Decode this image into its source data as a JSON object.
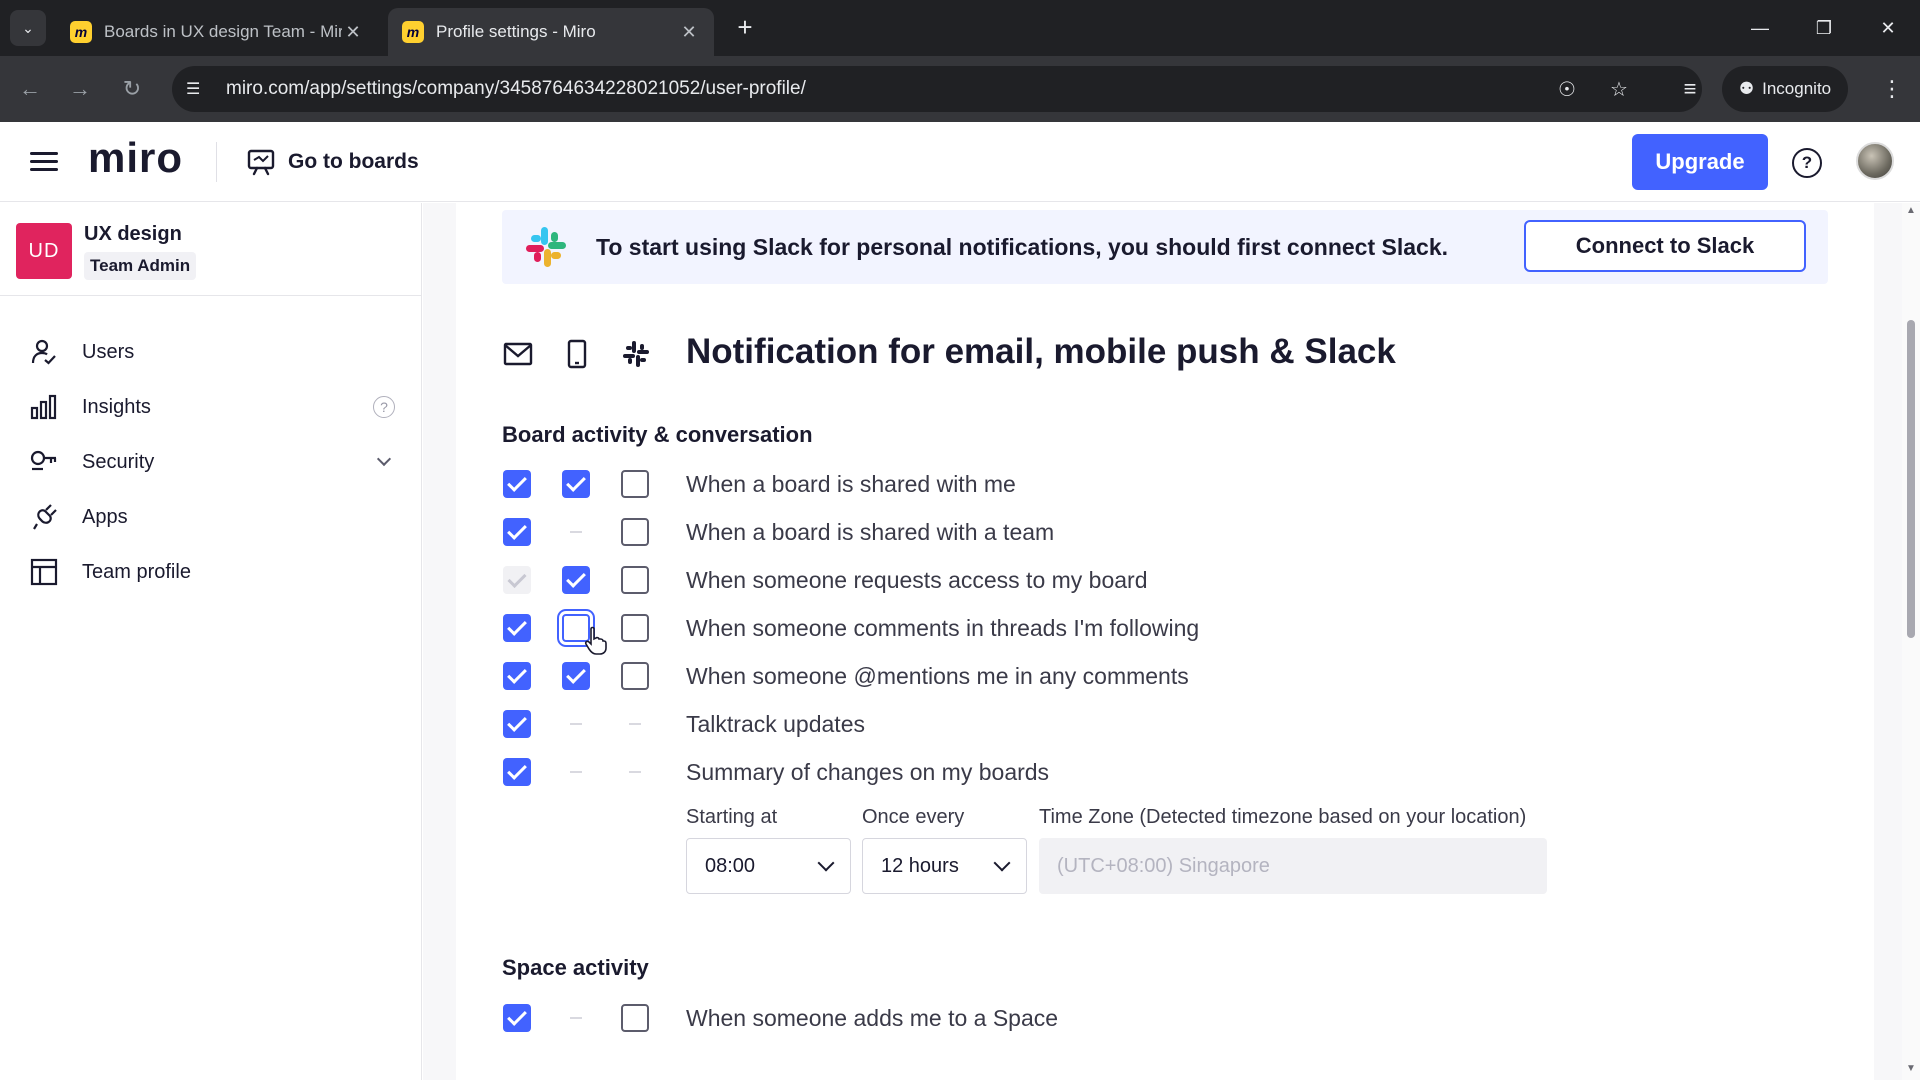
{
  "browser": {
    "tabs": [
      {
        "title": "Boards in UX design Team - Miro",
        "active": false
      },
      {
        "title": "Profile settings - Miro",
        "active": true
      }
    ],
    "favicon_letter": "m",
    "url": "miro.com/app/settings/company/3458764634228021052/user-profile/",
    "incognito_label": "Incognito"
  },
  "header": {
    "logo": "miro",
    "go_to_boards": "Go to boards",
    "upgrade": "Upgrade",
    "help": "?"
  },
  "sidebar": {
    "team_initials": "UD",
    "team_name": "UX design",
    "team_role": "Team Admin",
    "items": [
      {
        "label": "Users",
        "icon": "user-check-icon"
      },
      {
        "label": "Insights",
        "icon": "bar-chart-icon"
      },
      {
        "label": "Security",
        "icon": "key-icon"
      },
      {
        "label": "Apps",
        "icon": "plug-icon"
      },
      {
        "label": "Team profile",
        "icon": "layout-icon"
      }
    ]
  },
  "banner": {
    "text": "To start using Slack for personal notifications, you should first connect Slack.",
    "button": "Connect to Slack"
  },
  "notifications": {
    "title": "Notification for email, mobile push & Slack",
    "columns": [
      "email-icon",
      "mobile-icon",
      "slack-icon"
    ],
    "groups": [
      {
        "title": "Board activity & conversation",
        "rows": [
          {
            "label": "When a board is shared with me",
            "email": "on",
            "mobile": "on",
            "slack": "off"
          },
          {
            "label": "When a board is shared with a team",
            "email": "on",
            "mobile": "none",
            "slack": "off"
          },
          {
            "label": "When someone requests access to my board",
            "email": "disabled",
            "mobile": "on",
            "slack": "off"
          },
          {
            "label": "When someone comments in threads I'm following",
            "email": "on",
            "mobile": "focus",
            "slack": "off"
          },
          {
            "label": "When someone @mentions me in any comments",
            "email": "on",
            "mobile": "on",
            "slack": "off"
          },
          {
            "label": "Talktrack updates",
            "email": "on",
            "mobile": "none",
            "slack": "none"
          },
          {
            "label": "Summary of changes on my boards",
            "email": "on",
            "mobile": "none",
            "slack": "none"
          }
        ]
      },
      {
        "title": "Space activity",
        "rows": [
          {
            "label": "When someone adds me to a Space",
            "email": "on",
            "mobile": "none",
            "slack": "off"
          }
        ]
      }
    ],
    "summary_settings": {
      "starting_at_label": "Starting at",
      "starting_at_value": "08:00",
      "once_every_label": "Once every",
      "once_every_value": "12 hours",
      "timezone_label": "Time Zone  (Detected timezone based on your location)",
      "timezone_value": "(UTC+08:00) Singapore"
    }
  },
  "colors": {
    "accent": "#4262ff",
    "team_badge": "#e0245e",
    "banner_bg": "#f2f4ff"
  }
}
